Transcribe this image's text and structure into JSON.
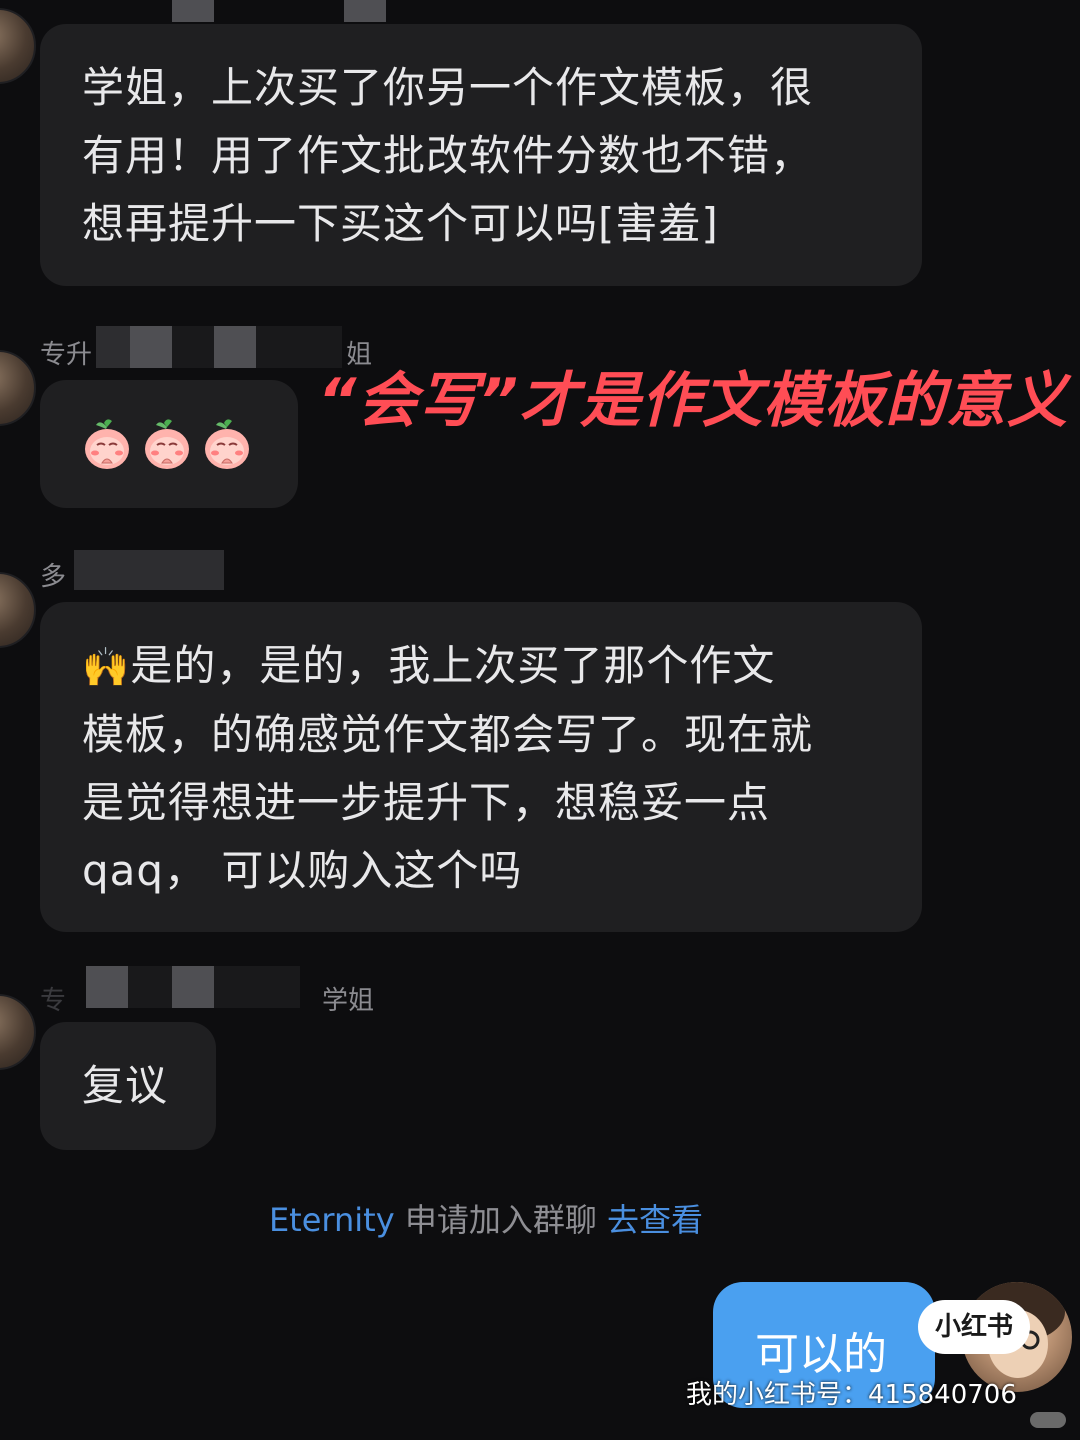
{
  "messages": {
    "m1": {
      "text": "学姐，上次买了你另一个作文模板，很\n有用！用了作文批改软件分数也不错，\n想再提升一下买这个可以吗[害羞]"
    },
    "m2": {
      "sender_prefix": "专升",
      "sender_suffix": "姐",
      "emoji_count": 3,
      "emoji_name": "peach-pray-emoji"
    },
    "m3": {
      "sender_prefix": "多",
      "text": "是的，是的，我上次买了那个作文\n模板，的确感觉作文都会写了。现在就\n是觉得想进一步提升下，想稳妥一点\nqaq， 可以购入这个吗"
    },
    "m4": {
      "sender_prefix": "专",
      "sender_suffix": "学姐",
      "text": "复议"
    }
  },
  "overlay": {
    "caption": "“会写”才是作文模板的意义",
    "caption_color": "#ff4d55"
  },
  "system_message": {
    "user": "Eternity",
    "action": " 申请加入群聊 ",
    "link": "去查看"
  },
  "my_message": {
    "text": "可以的",
    "bubble_color": "#4aa0f0"
  },
  "brand": {
    "logo_text": "小红书",
    "watermark": "我的小红书号：415840706"
  }
}
